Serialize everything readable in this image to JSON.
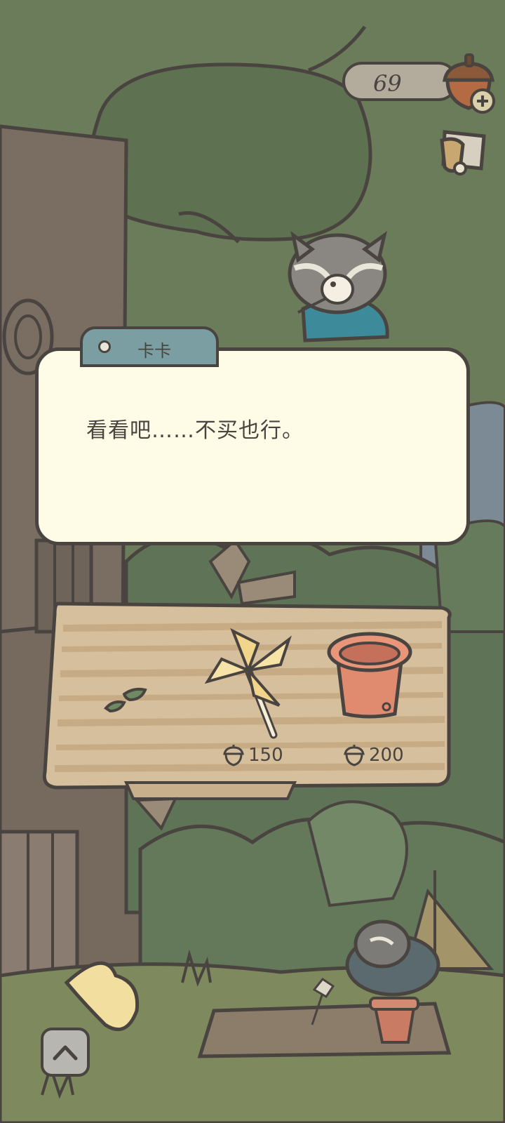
{
  "currency": {
    "acorns": "69",
    "acorn_icon": "acorn-icon",
    "add_icon": "plus-icon"
  },
  "mail_icon": "mailbox-icon",
  "dialog": {
    "speaker": "卡卡",
    "text": "看看吧……不买也行。"
  },
  "shop": {
    "items": [
      {
        "icon": "leaf-icon",
        "price": ""
      },
      {
        "icon": "pinwheel-icon",
        "price": "150"
      },
      {
        "icon": "flower-pot-icon",
        "price": "200"
      }
    ]
  },
  "nav": {
    "up_icon": "chevron-up-icon"
  },
  "colors": {
    "background_green": "#6b7c5a",
    "dialog_fill": "#fefbe6",
    "tag_fill": "#7b9ea2",
    "outline": "#4a4440"
  }
}
